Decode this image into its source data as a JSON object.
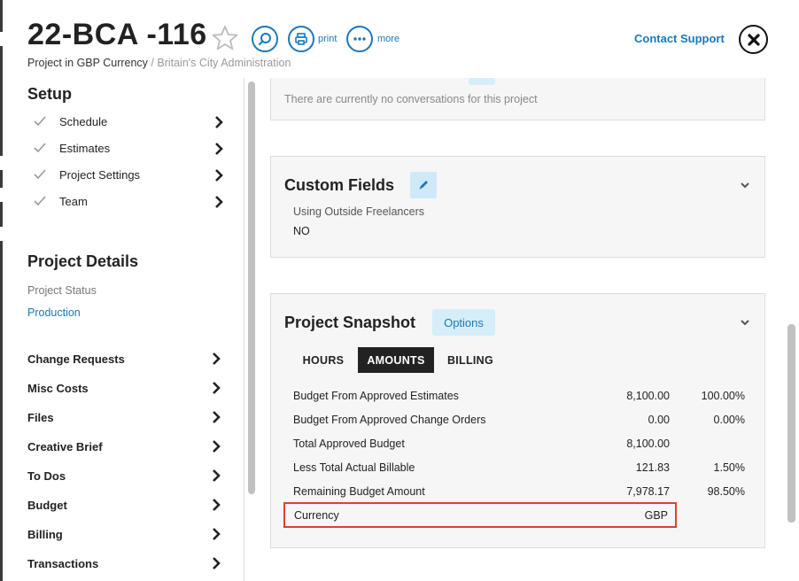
{
  "header": {
    "title": "22-BCA -116",
    "subtitle_prefix": "Project in GBP Currency",
    "subtitle_separator": " / ",
    "subtitle_client": "Britain's City Administration",
    "print_label": "print",
    "more_label": "more",
    "contact_label": "Contact Support"
  },
  "sidebar": {
    "setup_title": "Setup",
    "setup_items": [
      {
        "label": "Schedule"
      },
      {
        "label": "Estimates"
      },
      {
        "label": "Project Settings"
      },
      {
        "label": "Team"
      }
    ],
    "details_title": "Project Details",
    "status_label": "Project Status",
    "status_value": "Production",
    "nav_items": [
      {
        "label": "Change Requests"
      },
      {
        "label": "Misc Costs"
      },
      {
        "label": "Files"
      },
      {
        "label": "Creative Brief"
      },
      {
        "label": "To Dos"
      },
      {
        "label": "Budget"
      },
      {
        "label": "Billing"
      },
      {
        "label": "Transactions"
      }
    ]
  },
  "main": {
    "conversations_text": "There are currently no conversations for this project",
    "custom_fields": {
      "title": "Custom Fields",
      "field_label": "Using Outside Freelancers",
      "field_value": "NO"
    },
    "snapshot": {
      "title": "Project Snapshot",
      "options_label": "Options",
      "tabs": [
        {
          "label": "HOURS",
          "active": false
        },
        {
          "label": "AMOUNTS",
          "active": true
        },
        {
          "label": "BILLING",
          "active": false
        }
      ],
      "rows": [
        {
          "label": "Budget From Approved Estimates",
          "amount": "8,100.00",
          "percent": "100.00%"
        },
        {
          "label": "Budget From Approved Change Orders",
          "amount": "0.00",
          "percent": "0.00%"
        },
        {
          "label": "Total Approved Budget",
          "amount": "8,100.00",
          "percent": ""
        },
        {
          "label": "Less Total Actual Billable",
          "amount": "121.83",
          "percent": "1.50%"
        },
        {
          "label": "Remaining Budget Amount",
          "amount": "7,978.17",
          "percent": "98.50%"
        }
      ],
      "currency_label": "Currency",
      "currency_value": "GBP"
    }
  },
  "colors": {
    "accent": "#1a78b8",
    "highlight": "#d9442e",
    "active_tab": "#222222"
  }
}
